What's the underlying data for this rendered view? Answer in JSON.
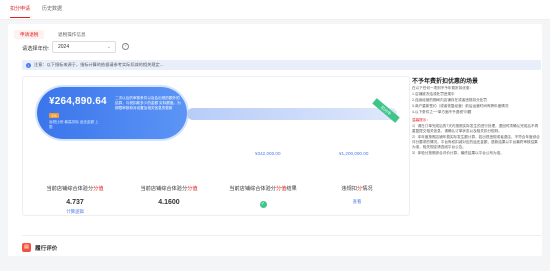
{
  "top_tabs": [
    "扣分申请",
    "历史数据"
  ],
  "sub_tabs": [
    "申请退税",
    "退税操作信息"
  ],
  "filter": {
    "label": "请选择年份:",
    "value": "2024"
  },
  "notice": "注意：以下指标来源于，指标计算的依据请参考实际扣减的相关规定...",
  "summary": {
    "amount": "¥264,890.64",
    "badge": "1%",
    "sub": "返税比例 最高扣除 返还金额 上限",
    "desc": "二次以后的审核条件以及会出现的额外的结算，与税扣款多少的金额 实际额度。为期限审核和对设置及相关信息的更新",
    "ribbon": "扣分中",
    "flow_left": "¥342,000.00",
    "flow_right": "¥1,200,000.00"
  },
  "metrics": [
    {
      "label_pre": "当前店铺综合体验分",
      "label_hl": "分值",
      "value": "4.737",
      "link": "计算逻辑"
    },
    {
      "label_pre": "当前店铺综合体验分",
      "label_hl": "分值",
      "value": "4.1600",
      "link": ""
    },
    {
      "label_pre": "当前店铺综合体验分",
      "label_hl": "分值",
      "value": "",
      "link": "",
      "check": true,
      "label_post": "结果"
    },
    {
      "label_pre": "违规扣",
      "label_hl": "分",
      "value": "",
      "link": "查看",
      "label_post": "情况"
    }
  ],
  "side": {
    "title": "不予年费折扣优惠的场景",
    "intro": "在以下任何一项则不予年费折扣优惠：",
    "items": [
      "1.店铺被冻结或处罚违规中",
      "2.连续经营的期间内店铺存在或者违规扣分处罚",
      "3.商户重新签约（或者恢复经营）前后运营时间有跨年度情况",
      "4.以下条件之一“单方面不予退税”问题"
    ],
    "note_title": "温馨提示：",
    "notes": [
      "1）请在订单完成后的7天内按照实际发生的进行处理，退回时须确认完成后不再重复提交相关信息，请确认订单状态以及相关扣分规则。",
      "2）本年度按照店铺年费实际发生额计算，若出现违规或者退店、不符合年度综合评分要求的情况，平台有权扣减对应的返还金额，退款结果以平台最终审核结果为准，相关规定请查阅平台公告。",
      "3）体验分按照综合评价计算，最终结果以平台公布为准。"
    ]
  },
  "evaluation_label": "履行评价"
}
